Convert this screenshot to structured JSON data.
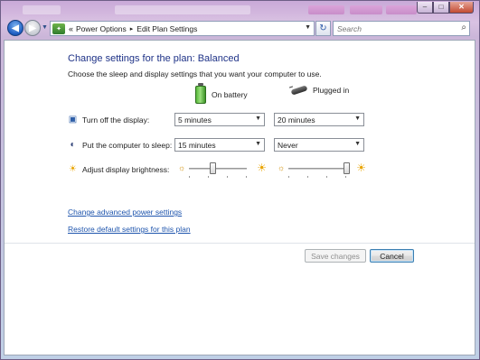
{
  "window": {
    "minimize_glyph": "–",
    "maximize_glyph": "□",
    "close_glyph": "✕"
  },
  "nav": {
    "back_glyph": "◀",
    "forward_glyph": "▶",
    "address_sep": "«",
    "breadcrumb": [
      "Power Options",
      "Edit Plan Settings"
    ],
    "crumb_arrow": "▸",
    "refresh_glyph": "↻",
    "search_placeholder": "Search"
  },
  "main": {
    "heading": "Change settings for the plan: Balanced",
    "subheading": "Choose the sleep and display settings that you want your computer to use.",
    "columns": {
      "battery": "On battery",
      "plugged": "Plugged in"
    },
    "settings": [
      {
        "label": "Turn off the display:",
        "icon": "display-icon",
        "battery": "5 minutes",
        "plugged": "20 minutes"
      },
      {
        "label": "Put the computer to sleep:",
        "icon": "moon-icon",
        "battery": "15 minutes",
        "plugged": "Never"
      }
    ],
    "brightness": {
      "label": "Adjust display brightness:",
      "battery_level": 0.4,
      "plugged_level": 1.0
    },
    "links": {
      "advanced": "Change advanced power settings",
      "restore": "Restore default settings for this plan"
    },
    "buttons": {
      "save": "Save changes",
      "cancel": "Cancel"
    }
  }
}
